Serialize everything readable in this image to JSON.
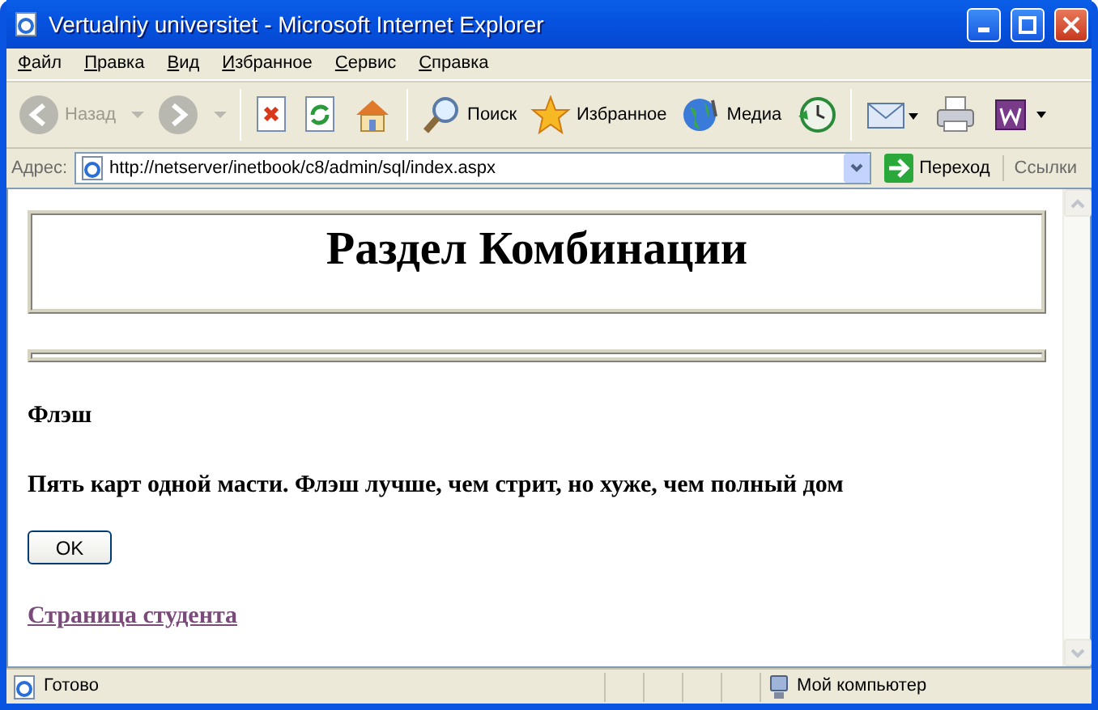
{
  "window": {
    "title": "Vertualniy universitet - Microsoft Internet Explorer"
  },
  "menu": [
    "Файл",
    "Правка",
    "Вид",
    "Избранное",
    "Сервис",
    "Справка"
  ],
  "toolbar": [
    {
      "kind": "back",
      "label": "Назад",
      "disabled": true
    },
    {
      "kind": "forward",
      "disabled": true
    },
    {
      "kind": "stop"
    },
    {
      "kind": "refresh"
    },
    {
      "kind": "home"
    },
    {
      "kind": "search",
      "label": "Поиск"
    },
    {
      "kind": "favorites",
      "label": "Избранное"
    },
    {
      "kind": "media",
      "label": "Медиа"
    },
    {
      "kind": "history"
    },
    {
      "kind": "mail"
    },
    {
      "kind": "print"
    },
    {
      "kind": "word"
    }
  ],
  "address": {
    "label": "Адрес:",
    "url": "http://netserver/inetbook/c8/admin/sql/index.aspx",
    "go": "Переход",
    "links": "Ссылки"
  },
  "page": {
    "heading": "Раздел Комбинации",
    "subtitle": "Флэш",
    "description": "Пять карт одной масти. Флэш лучше, чем стрит, но хуже, чем полный дом",
    "button": "OK",
    "link": "Страница студента"
  },
  "status_bar": {
    "text": "Готово",
    "zone": "Мой компьютер"
  }
}
